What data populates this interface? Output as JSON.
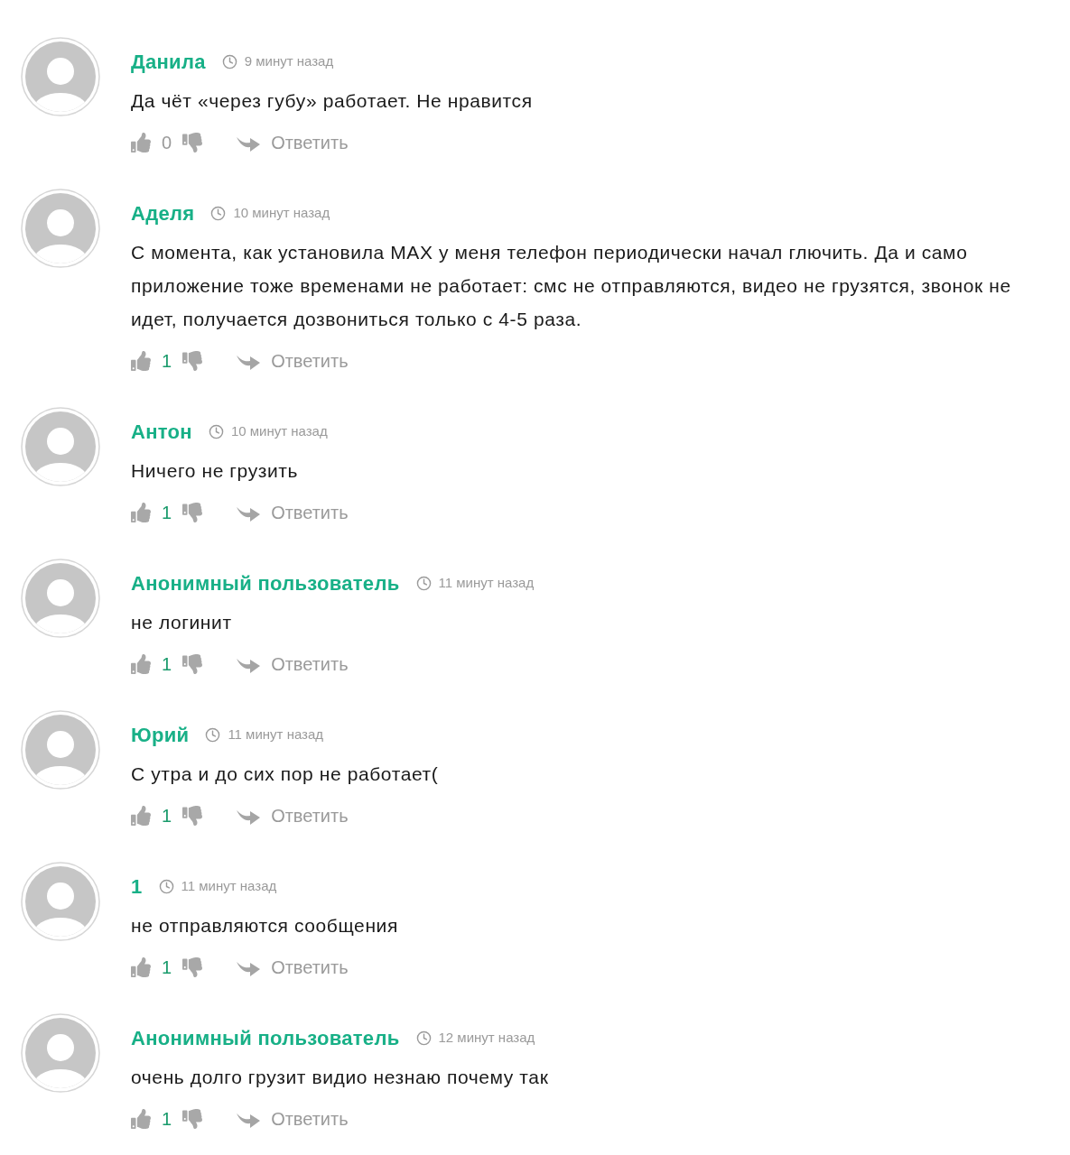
{
  "comments": [
    {
      "author": "Данила",
      "time": "9 минут назад",
      "text": "Да чёт «через губу» работает. Не нравится",
      "score": "0",
      "score_positive": false,
      "reply": "Ответить"
    },
    {
      "author": "Аделя",
      "time": "10 минут назад",
      "text": "С момента, как установила MAX у меня телефон периодически начал глючить. Да и само приложение тоже временами не работает: смс не отправляются, видео не грузятся, звонок не идет, получается дозвониться только с 4-5 раза.",
      "score": "1",
      "score_positive": true,
      "reply": "Ответить"
    },
    {
      "author": "Антон",
      "time": "10 минут назад",
      "text": "Ничего не грузить",
      "score": "1",
      "score_positive": true,
      "reply": "Ответить"
    },
    {
      "author": "Анонимный пользователь",
      "time": "11 минут назад",
      "text": "не логинит",
      "score": "1",
      "score_positive": true,
      "reply": "Ответить"
    },
    {
      "author": "Юрий",
      "time": "11 минут назад",
      "text": "С утра и до сих пор не работает(",
      "score": "1",
      "score_positive": true,
      "reply": "Ответить"
    },
    {
      "author": "1",
      "time": "11 минут назад",
      "text": "не отправляются сообщения",
      "score": "1",
      "score_positive": true,
      "reply": "Ответить"
    },
    {
      "author": "Анонимный пользователь",
      "time": "12 минут назад",
      "text": "очень долго грузит видио незнаю почему так",
      "score": "1",
      "score_positive": true,
      "reply": "Ответить"
    }
  ]
}
